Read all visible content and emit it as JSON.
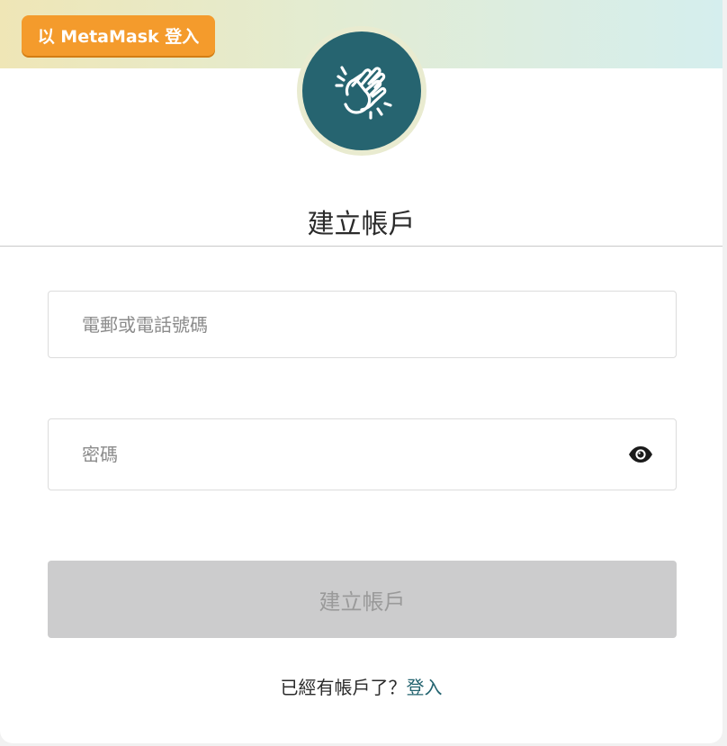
{
  "header": {
    "metamask_button_label": "以 MetaMask 登入",
    "logo_icon": "clapping-hands-icon"
  },
  "form": {
    "title": "建立帳戶",
    "email_placeholder": "電郵或電話號碼",
    "password_placeholder": "密碼",
    "password_toggle_icon": "eye-icon",
    "submit_label": "建立帳戶"
  },
  "footer": {
    "prompt": "已經有帳戶了？",
    "login_link": "登入"
  },
  "colors": {
    "accent_orange": "#f49b2c",
    "logo_teal": "#266470",
    "disabled_button": "#cccccd",
    "link": "#246470"
  }
}
